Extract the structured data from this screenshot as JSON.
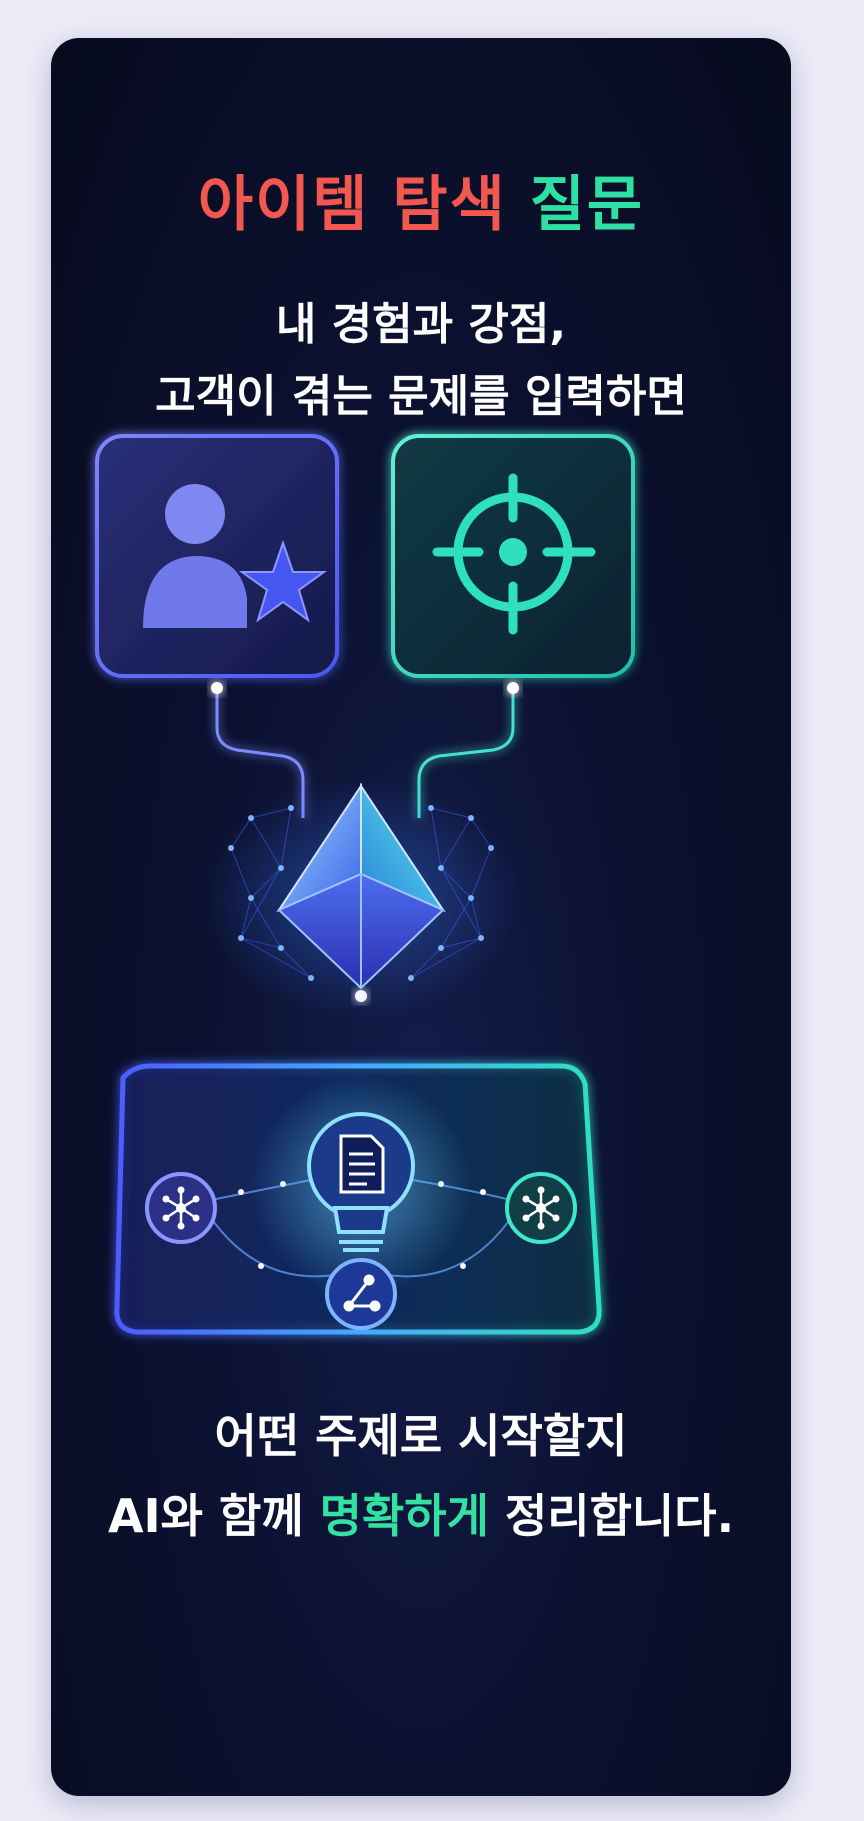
{
  "header": {
    "title_part1": "아이템 탐색",
    "title_part2": "질문",
    "subtitle_line1": "내 경험과 강점,",
    "subtitle_line2": "고객이 겪는 문제를 입력하면"
  },
  "icons": {
    "left_box": "user-star-icon",
    "right_box": "target-icon",
    "center": "crystal-pyramid-icon",
    "bulb": "lightbulb-document-icon",
    "nodes": [
      "network-node-icon",
      "network-node-icon",
      "share-node-icon"
    ]
  },
  "footer": {
    "line1": "어떤 주제로 시작할지",
    "line2_prefix": "AI와 함께 ",
    "line2_highlight": "명확하게",
    "line2_suffix": " 정리합니다."
  },
  "colors": {
    "title_red": "#f2584f",
    "title_green": "#2fe0a4",
    "accent_blue": "#5a6cff",
    "accent_teal": "#2fe0c0",
    "card_bg": "#0b1130"
  }
}
